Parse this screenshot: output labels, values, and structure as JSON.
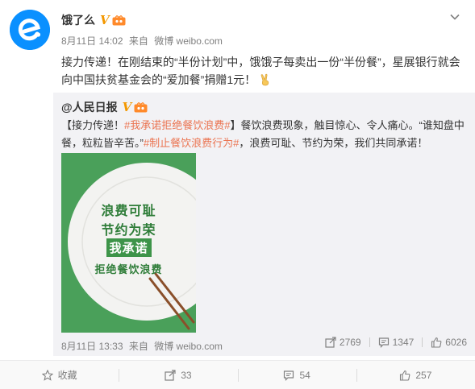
{
  "post": {
    "author": "饿了么",
    "verified_mark": "V",
    "meta": {
      "date": "8月11日 14:02",
      "source_prefix": "来自",
      "source": "微博 weibo.com"
    },
    "text": "接力传递！在刚结束的“半份计划”中，饿饿子每卖出一份“半份餐”，星展银行就会向中国扶贫基金会的“爱加餐”捐赠1元！",
    "emoji": "victory-hand-icon"
  },
  "repost": {
    "author": "@人民日报",
    "verified_mark": "V",
    "text_parts": {
      "p1": "【接力传递！",
      "tag1": "#我承诺拒绝餐饮浪费#",
      "p2": "】餐饮浪费现象，触目惊心、令人痛心。“谁知盘中餐，粒粒皆辛苦。”",
      "tag2": "#制止餐饮浪费行为#",
      "p3": "，浪费可耻、节约为荣，我们共同承诺！"
    },
    "poster": {
      "line1": "浪费可耻",
      "line2": "节约为荣",
      "tag": "我承诺",
      "line3": "拒绝餐饮浪费"
    },
    "meta": {
      "date": "8月11日 13:33",
      "source_prefix": "来自",
      "source": "微博 weibo.com"
    },
    "actions": {
      "reposts": "2769",
      "comments": "1347",
      "likes": "6026"
    }
  },
  "bottom_bar": {
    "favorite_label": "收藏",
    "repost_count": "33",
    "comment_count": "54",
    "like_count": "257"
  },
  "colors": {
    "accent": "#eb7350",
    "brand_blue": "#0a90ff",
    "verified": "#f39800",
    "poster_green": "#4aa05a"
  }
}
